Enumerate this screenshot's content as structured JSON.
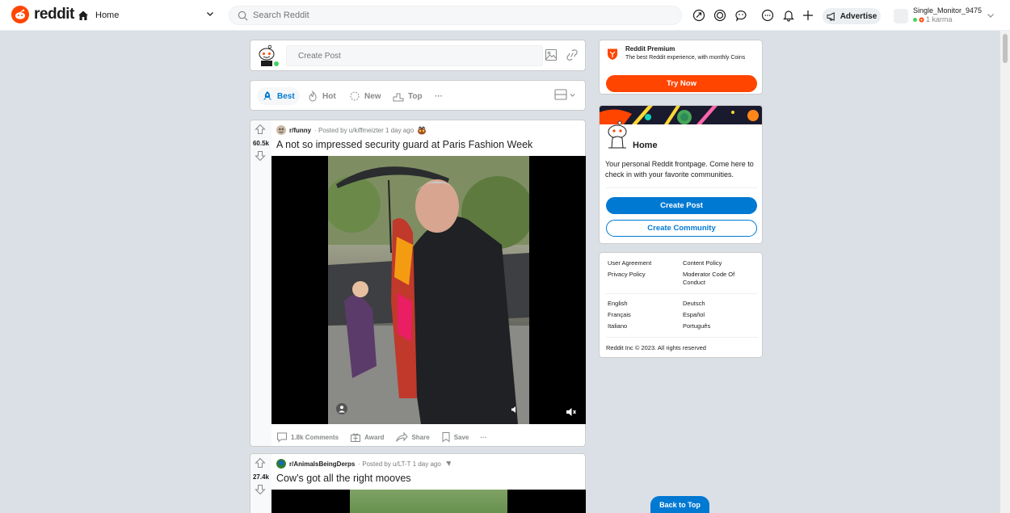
{
  "header": {
    "brand": "reddit",
    "home_label": "Home",
    "search_placeholder": "Search Reddit",
    "advertise_label": "Advertise",
    "username": "Single_Monitor_9475",
    "karma": "1 karma",
    "icons": [
      "popular-icon",
      "coins-icon",
      "chat-icon",
      "messages-icon",
      "notifications-icon",
      "plus-icon",
      "megaphone-icon"
    ]
  },
  "create_post": {
    "placeholder": "Create Post"
  },
  "sort": {
    "items": [
      "Best",
      "Hot",
      "New",
      "Top"
    ],
    "more": "···"
  },
  "posts": [
    {
      "subreddit": "r/funny",
      "posted_by": "· Posted by u/kiffmeizter 1 day ago",
      "score": "60.5k",
      "title": "A not so impressed security guard at Paris Fashion Week",
      "comments": "1.8k Comments",
      "award": "Award",
      "share": "Share",
      "save": "Save",
      "more": "···"
    },
    {
      "subreddit": "r/AnimalsBeingDerps",
      "posted_by": "· Posted by u/LT-T 1 day ago",
      "score": "27.4k",
      "title": "Cow’s got all the right mooves"
    }
  ],
  "premium": {
    "title": "Reddit Premium",
    "description": "The best Reddit experience, with monthly Coins",
    "button": "Try Now"
  },
  "home_card": {
    "title": "Home",
    "description": "Your personal Reddit frontpage. Come here to check in with your favorite communities.",
    "create_post": "Create Post",
    "create_community": "Create Community"
  },
  "footer_links": {
    "col1a": [
      "User Agreement",
      "Privacy Policy"
    ],
    "col2a": [
      "Content Policy",
      "Moderator Code Of Conduct"
    ],
    "col1b": [
      "English",
      "Français",
      "Italiano"
    ],
    "col2b": [
      "Deutsch",
      "Español",
      "Português"
    ],
    "copyright": "Reddit Inc © 2023. All rights reserved"
  },
  "back_to_top": "Back to Top",
  "colors": {
    "accent": "#0079d3",
    "brand": "#ff4500",
    "background": "#dae0e6"
  }
}
